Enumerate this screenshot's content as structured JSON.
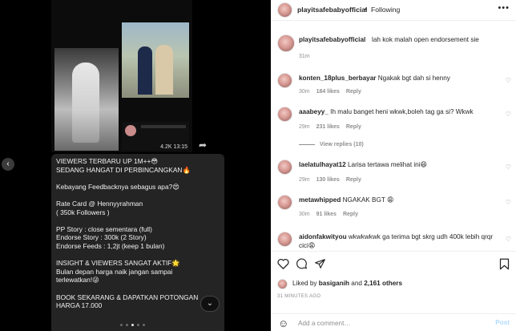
{
  "header": {
    "username": "playitsafebabyofficial",
    "separator": "•",
    "follow_status": "Following",
    "more_label": "•••"
  },
  "caption": {
    "username": "playitsafebabyofficial",
    "text": "lah kok malah open endorsement sie",
    "time": "31m"
  },
  "media": {
    "stats": "4.2K 13:15",
    "caption_lines": [
      "VIEWERS TERBARU UP 1M++😳",
      "SEDANG HANGAT DI PERBINCANGKAN🔥",
      "",
      "Kebayang Feedbacknya sebagus apa?😍",
      "",
      "Rate Card @ Hennyyrahman",
      "( 350k Followers )",
      "",
      "PP Story : close sementara (full)",
      "Endorse Story : 300k (2 Story)",
      "Endorse Feeds : 1,2jt (keep 1 bulan)",
      "",
      "INSIGHT & VIEWERS SANGAT AKTIF🌟",
      "Bulan depan harga naik jangan sampai",
      "terlewatkan!😜",
      "",
      "BOOK SEKARANG & DAPATKAN POTONGAN",
      "HARGA 17.000"
    ],
    "nav_prev_icon": "‹",
    "scroll_icon": "⌄"
  },
  "comments": [
    {
      "username": "konten_18plus_berbayar",
      "text": "Ngakak bgt dah si henny",
      "time": "30m",
      "likes": "184 likes",
      "reply": "Reply"
    },
    {
      "username": "aaabeyy_",
      "text": "Ih malu banget heni wkwk,boleh tag ga si? Wkwk",
      "time": "29m",
      "likes": "231 likes",
      "reply": "Reply"
    },
    {
      "username": "laelatulhayat12",
      "text": "Larisa tertawa melihat ini😄",
      "time": "29m",
      "likes": "130 likes",
      "reply": "Reply"
    },
    {
      "username": "metawhipped",
      "text": "NGAKAK BGT 😩",
      "time": "30m",
      "likes": "91 likes",
      "reply": "Reply"
    },
    {
      "username": "aidonfakwityou",
      "text": "wkwkwkwk ga terima bgt skrg udh 400k lebih qrqr cici😩",
      "time": "",
      "likes": "",
      "reply": ""
    }
  ],
  "view_replies": "View replies (10)",
  "actions": {
    "like_icon": "heart-icon",
    "comment_icon": "comment-icon",
    "share_icon": "share-icon",
    "save_icon": "bookmark-icon"
  },
  "likes": {
    "prefix": "Liked by",
    "user": "basiganih",
    "middle": "and",
    "others": "2,161 others"
  },
  "time_ago": "31 MINUTES AGO",
  "add_comment": {
    "placeholder": "Add a comment…",
    "post_label": "Post"
  },
  "colors": {
    "post_disabled": "#b3dbff",
    "meta_gray": "#8e8e8e",
    "text": "#262626"
  }
}
